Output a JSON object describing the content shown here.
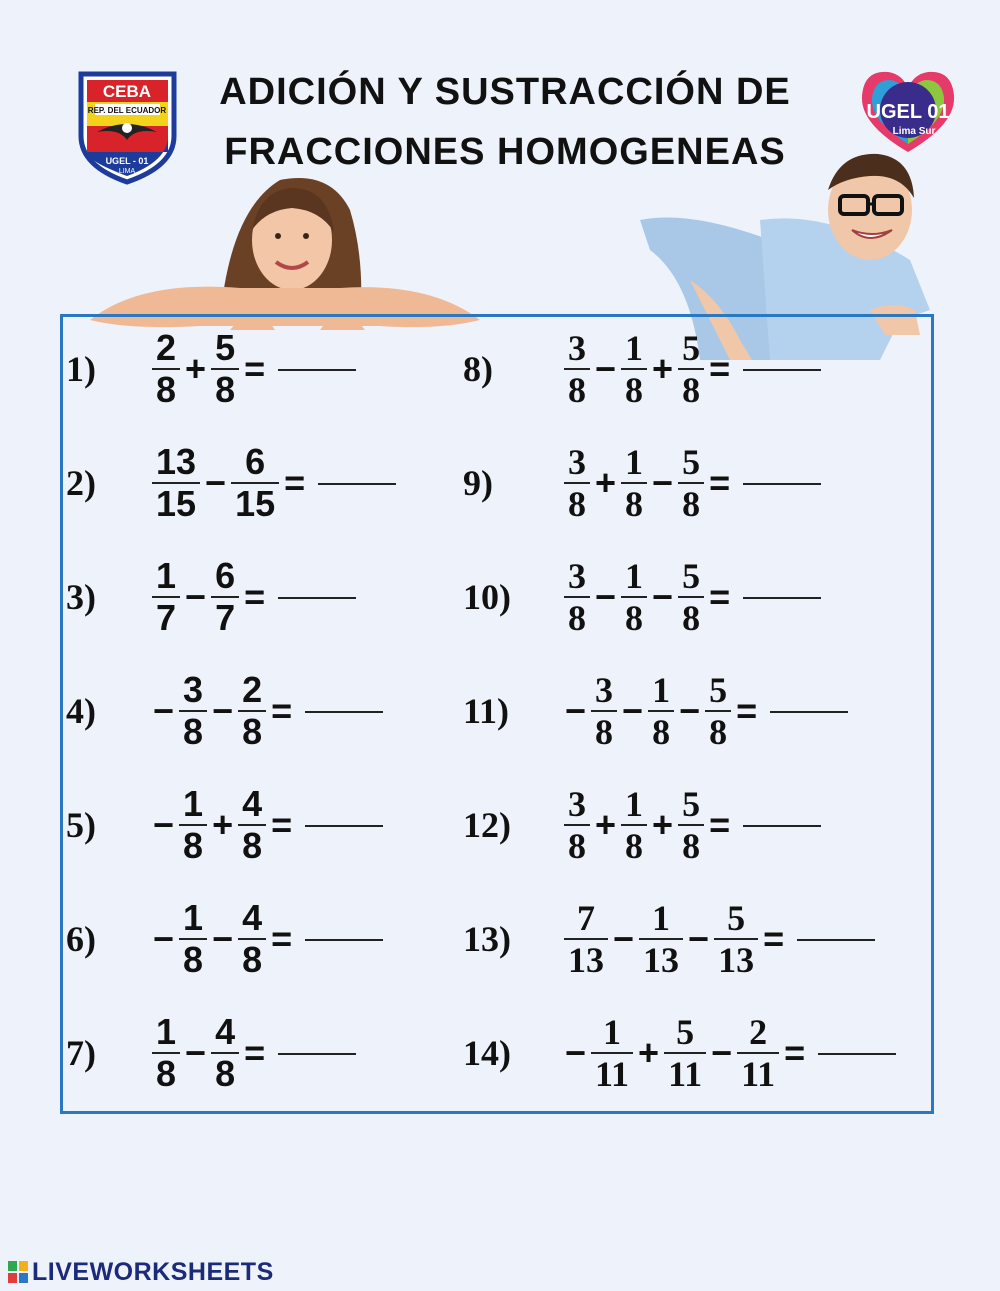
{
  "header": {
    "title_line1": "ADICIÓN Y SUSTRACCIÓN DE",
    "title_line2": "FRACCIONES HOMOGENEAS",
    "logo_left": {
      "top_text": "CEBA",
      "band_text": "REP. DEL ECUADOR",
      "bottom_text": "UGEL - 01",
      "sub_text": "LIMA"
    },
    "logo_right": {
      "main_text": "UGEL 01",
      "sub_text": "Lima Sur"
    }
  },
  "exercises_left": [
    {
      "label": "1)",
      "terms": [
        {
          "op": "",
          "n": "2",
          "d": "8"
        },
        {
          "op": "+",
          "n": "5",
          "d": "8"
        }
      ]
    },
    {
      "label": "2)",
      "terms": [
        {
          "op": "",
          "n": "13",
          "d": "15"
        },
        {
          "op": "−",
          "n": "6",
          "d": "15"
        }
      ]
    },
    {
      "label": "3)",
      "terms": [
        {
          "op": "",
          "n": "1",
          "d": "7"
        },
        {
          "op": "−",
          "n": "6",
          "d": "7"
        }
      ]
    },
    {
      "label": "4)",
      "terms": [
        {
          "op": "−",
          "n": "3",
          "d": "8"
        },
        {
          "op": "−",
          "n": "2",
          "d": "8"
        }
      ]
    },
    {
      "label": "5)",
      "terms": [
        {
          "op": "−",
          "n": "1",
          "d": "8"
        },
        {
          "op": "+",
          "n": "4",
          "d": "8"
        }
      ]
    },
    {
      "label": "6)",
      "terms": [
        {
          "op": "−",
          "n": "1",
          "d": "8"
        },
        {
          "op": "−",
          "n": "4",
          "d": "8"
        }
      ]
    },
    {
      "label": "7)",
      "terms": [
        {
          "op": "",
          "n": "1",
          "d": "8"
        },
        {
          "op": "−",
          "n": "4",
          "d": "8"
        }
      ]
    }
  ],
  "exercises_right": [
    {
      "label": "8)",
      "terms": [
        {
          "op": "",
          "n": "3",
          "d": "8"
        },
        {
          "op": "−",
          "n": "1",
          "d": "8"
        },
        {
          "op": "+",
          "n": "5",
          "d": "8"
        }
      ]
    },
    {
      "label": "9)",
      "terms": [
        {
          "op": "",
          "n": "3",
          "d": "8"
        },
        {
          "op": "+",
          "n": "1",
          "d": "8"
        },
        {
          "op": "−",
          "n": "5",
          "d": "8"
        }
      ]
    },
    {
      "label": "10)",
      "terms": [
        {
          "op": "",
          "n": "3",
          "d": "8"
        },
        {
          "op": "−",
          "n": "1",
          "d": "8"
        },
        {
          "op": "−",
          "n": "5",
          "d": "8"
        }
      ]
    },
    {
      "label": "11)",
      "terms": [
        {
          "op": "−",
          "n": "3",
          "d": "8"
        },
        {
          "op": "−",
          "n": "1",
          "d": "8"
        },
        {
          "op": "−",
          "n": "5",
          "d": "8"
        }
      ]
    },
    {
      "label": "12)",
      "terms": [
        {
          "op": "",
          "n": "3",
          "d": "8"
        },
        {
          "op": "+",
          "n": "1",
          "d": "8"
        },
        {
          "op": "+",
          "n": "5",
          "d": "8"
        }
      ]
    },
    {
      "label": "13)",
      "terms": [
        {
          "op": "",
          "n": "7",
          "d": "13"
        },
        {
          "op": "−",
          "n": "1",
          "d": "13"
        },
        {
          "op": "−",
          "n": "5",
          "d": "13"
        }
      ]
    },
    {
      "label": "14)",
      "terms": [
        {
          "op": "−",
          "n": "1",
          "d": "11"
        },
        {
          "op": "+",
          "n": "5",
          "d": "11"
        },
        {
          "op": "−",
          "n": "2",
          "d": "11"
        }
      ]
    }
  ],
  "equals_sign": "=",
  "footer": {
    "brand": "LIVEWORKSHEETS"
  },
  "colors": {
    "panel_border": "#2a78c2",
    "background": "#eef3fb",
    "brand": "#1b2a7a"
  }
}
